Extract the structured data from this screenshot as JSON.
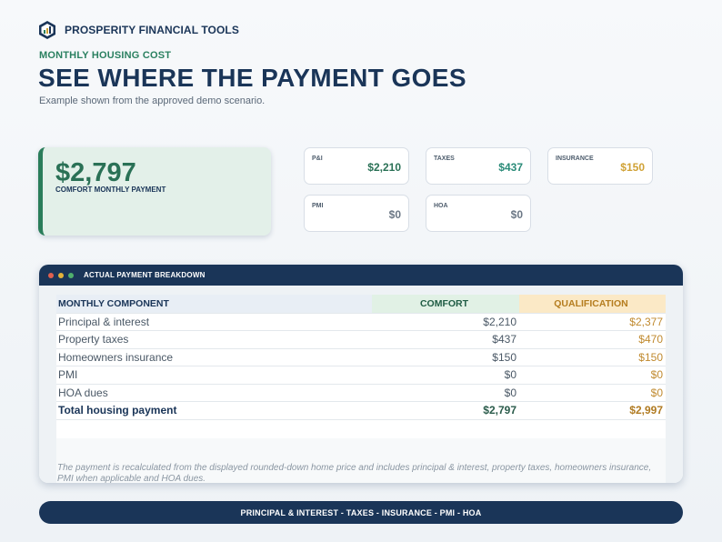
{
  "brand": {
    "name": "PROSPERITY FINANCIAL TOOLS",
    "logo_icon": "chart-logo-icon"
  },
  "header": {
    "eyebrow": "MONTHLY HOUSING COST",
    "title": "SEE WHERE THE PAYMENT GOES",
    "subtitle": "Example shown from the approved demo scenario."
  },
  "hero": {
    "value": "$2,797",
    "label": "COMFORT MONTHLY PAYMENT"
  },
  "metrics": [
    {
      "label": "P&I",
      "value": "$2,210",
      "color": "#2a7156"
    },
    {
      "label": "TAXES",
      "value": "$437",
      "color": "#2a8b78"
    },
    {
      "label": "INSURANCE",
      "value": "$150",
      "color": "#d0a236"
    },
    {
      "label": "PMI",
      "value": "$0",
      "color": "#6b7785"
    },
    {
      "label": "HOA",
      "value": "$0",
      "color": "#6b7785"
    }
  ],
  "window": {
    "title": "ACTUAL PAYMENT BREAKDOWN",
    "dot_colors": [
      "#e0604f",
      "#e3b23a",
      "#4fb06d"
    ]
  },
  "table": {
    "headers": [
      "MONTHLY COMPONENT",
      "COMFORT",
      "QUALIFICATION"
    ],
    "rows": [
      [
        "Principal & interest",
        "$2,210",
        "$2,377"
      ],
      [
        "Property taxes",
        "$437",
        "$470"
      ],
      [
        "Homeowners insurance",
        "$150",
        "$150"
      ],
      [
        "PMI",
        "$0",
        "$0"
      ],
      [
        "HOA dues",
        "$0",
        "$0"
      ]
    ],
    "total": [
      "Total housing payment",
      "$2,797",
      "$2,997"
    ]
  },
  "note": "The payment is recalculated from the displayed rounded-down home price and includes principal & interest, property taxes, homeowners insurance, PMI when applicable and HOA dues.",
  "footer": {
    "text": "PRINCIPAL & INTEREST - TAXES - INSURANCE - PMI - HOA"
  }
}
